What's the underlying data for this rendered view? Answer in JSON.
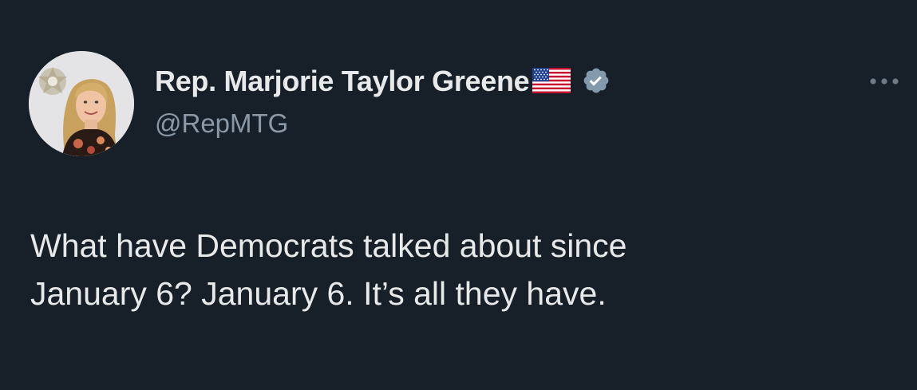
{
  "author": {
    "display_name": "Rep. Marjorie Taylor Greene",
    "handle": "@RepMTG",
    "flag": "us-flag-icon",
    "verified": "verified-badge-icon"
  },
  "tweet": {
    "text": "What have Democrats talked about since\nJanuary 6? January 6. It’s all they have."
  },
  "actions": {
    "more_icon": "more-options-icon"
  },
  "colors": {
    "background": "#172029",
    "primary_text": "#e7e9ea",
    "secondary_text": "#8b98a5",
    "verified_badge": "#829aab"
  }
}
